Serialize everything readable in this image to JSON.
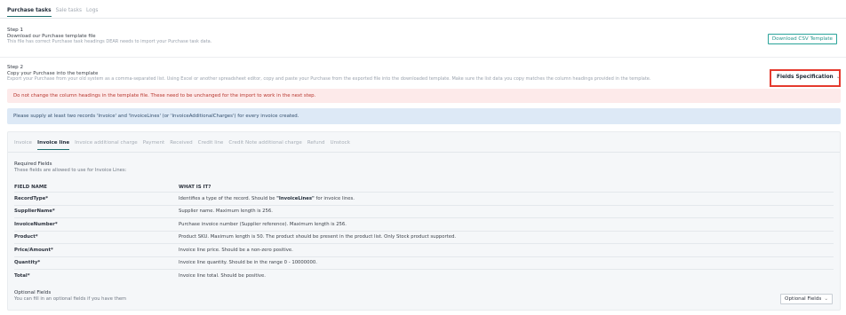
{
  "top_tabs": [
    "Purchase tasks",
    "Sale tasks",
    "Logs"
  ],
  "step1": {
    "title": "Step 1",
    "description": "Download our Purchase template file",
    "subtext": "This file has correct Purchase task headings DEAR needs to import your Purchase task data.",
    "button": "Download CSV Template"
  },
  "step2": {
    "title": "Step 2",
    "description": "Copy your Purchase into the template",
    "subtext": "Export your Purchase from your old system as a comma-separated list. Using Excel or another spreadsheet editor, copy and paste your Purchase from the exported file into the downloaded template. Make sure the list data you copy matches the column headings provided in the template.",
    "button": "Fields Specification"
  },
  "alerts": {
    "warning": "Do not change the column headings in the template file. These need to be unchanged for the import to work in the next step.",
    "info": "Please supply at least two records 'Invoice' and 'InvoiceLines' (or 'InvoiceAdditionalCharges') for every invoice created."
  },
  "inner_tabs": [
    "Invoice",
    "Invoice line",
    "Invoice additional charge",
    "Payment",
    "Received",
    "Credit line",
    "Credit Note additional charge",
    "Refund",
    "Unstock"
  ],
  "required": {
    "title": "Required Fields",
    "description": "These fields are allowed to use for Invoice Lines:",
    "col_field": "FIELD NAME",
    "col_what": "WHAT IS IT?",
    "rows": [
      {
        "field": "RecordType*",
        "desc_prefix": "Identifies a type of the record. Should be ",
        "desc_bold": "\"InvoiceLines\"",
        "desc_suffix": " for invoice lines."
      },
      {
        "field": "SupplierName*",
        "desc": "Supplier name. Maximum length is 256."
      },
      {
        "field": "InvoiceNumber*",
        "desc": "Purchase invoice number (Supplier reference). Maximum length is 256."
      },
      {
        "field": "Product*",
        "desc": "Product SKU. Maximum length is 50. The product should be present in the product list. Only Stock product supported."
      },
      {
        "field": "Price/Amount*",
        "desc": "Invoice line price. Should be a non-zero positive."
      },
      {
        "field": "Quantity*",
        "desc": "Invoice line quantity. Should be in the range 0 - 10000000."
      },
      {
        "field": "Total*",
        "desc": "Invoice line total. Should be positive."
      }
    ]
  },
  "optional": {
    "title": "Optional Fields",
    "description": "You can fill in an optional fields if you have them",
    "button": "Optional Fields"
  },
  "icons": {
    "dropdown": "chevron-down-icon"
  },
  "colors": {
    "accent": "#2aa39a",
    "highlight": "#e53a2e",
    "warning_bg": "#fdeaea",
    "info_bg": "#dde9f6"
  }
}
